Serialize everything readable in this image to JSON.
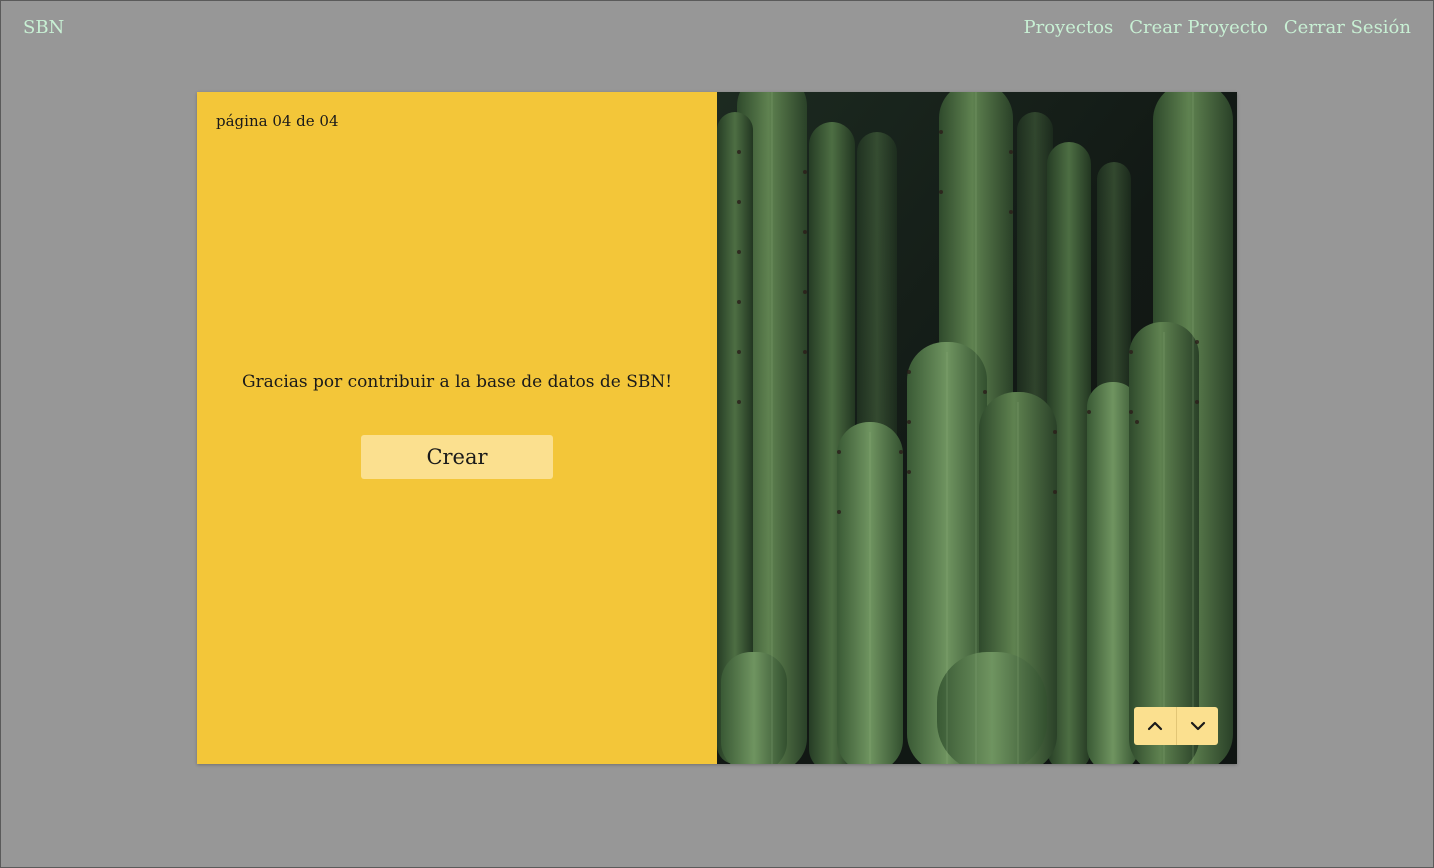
{
  "nav": {
    "brand": "SBN",
    "links": [
      "Proyectos",
      "Crear Proyecto",
      "Cerrar Sesión"
    ]
  },
  "form": {
    "page_indicator": "página 04 de 04",
    "message": "Gracias por contribuir a la base de datos de SBN!",
    "create_label": "Crear"
  },
  "image": {
    "subject": "cactus-photo"
  },
  "pager": {
    "prev_icon": "chevron-up-icon",
    "next_icon": "chevron-down-icon"
  },
  "colors": {
    "background": "#979797",
    "nav_text": "#c8f0d4",
    "panel": "#f3c639",
    "button": "#fbe08f"
  }
}
